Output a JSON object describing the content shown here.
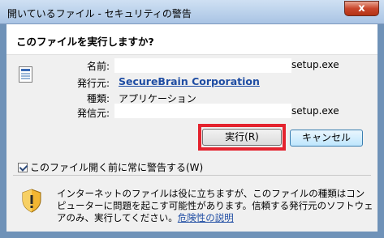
{
  "window": {
    "title": "開いているファイル - セキュリティの警告",
    "close_label": "x"
  },
  "prompt": {
    "question": "このファイルを実行しますか?"
  },
  "details": {
    "name_label": "名前:",
    "name_value": "setup.exe",
    "publisher_label": "発行元:",
    "publisher_value": "SecureBrain Corporation",
    "type_label": "種類:",
    "type_value": "アプリケーション",
    "from_label": "発信元:",
    "from_value": "setup.exe"
  },
  "buttons": {
    "run_label": "実行(R)",
    "cancel_label": "キャンセル"
  },
  "checkbox": {
    "label": "このファイル開く前に常に警告する(W)",
    "checked": true
  },
  "warning": {
    "text": "インターネットのファイルは役に立ちますが、このファイルの種類はコンピューターに問題を起こす可能性があります。信頼する発行元のソフトウェアのみ、実行してください。",
    "link_label": "危険性の説明"
  },
  "colors": {
    "highlight": "#e4232e",
    "link": "#1f4da3"
  }
}
